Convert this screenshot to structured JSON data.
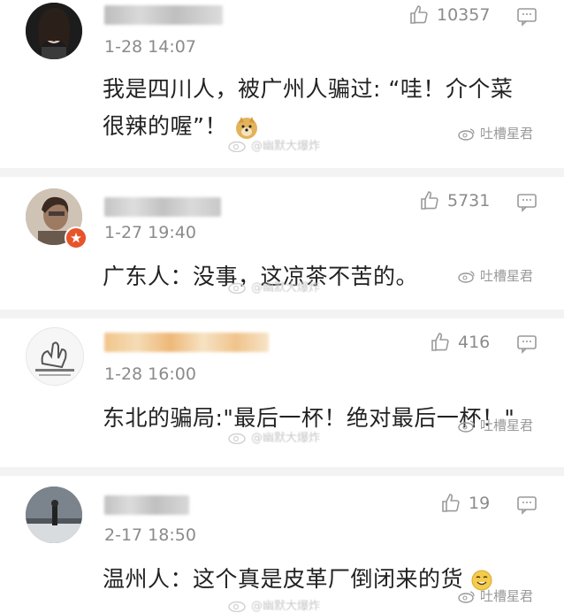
{
  "comments": [
    {
      "time": "1-28 14:07",
      "likes": "10357",
      "text_line1": "我是四川人，被广州人骗过: “哇！介个菜",
      "text_line2": "很辣的喔”！"
    },
    {
      "time": "1-27 19:40",
      "likes": "5731",
      "text_line1": "广东人：没事，这凉茶不苦的。"
    },
    {
      "time": "1-28 16:00",
      "likes": "416",
      "text_line1": "东北的骗局:\"最后一杯！绝对最后一杯！\""
    },
    {
      "time": "2-17 18:50",
      "likes": "19",
      "text_line1": "温州人：这个真是皮革厂倒闭来的货"
    }
  ],
  "watermark": {
    "right": "吐槽星君",
    "center": "@幽默大爆炸"
  },
  "icons": {
    "like": "thumbs-up-icon",
    "reply": "comment-bubble-icon",
    "watermark": "weibo-logo-icon"
  }
}
